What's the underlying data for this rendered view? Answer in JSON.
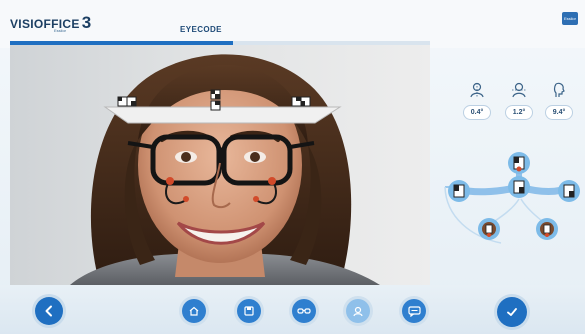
{
  "header": {
    "logo_text": "VISIOFFICE",
    "logo_number": "3",
    "logo_subtitle": "Essilor",
    "title": "EYECODE",
    "progress": 0.53,
    "brand_badge": "Essilor"
  },
  "measurements": {
    "angles": [
      {
        "icon": "head-tilt-icon",
        "value": "0.4°"
      },
      {
        "icon": "head-turn-icon",
        "value": "1.2°"
      },
      {
        "icon": "head-profile-icon",
        "value": "9.4°"
      }
    ]
  },
  "toolbar": {
    "back": "back-icon",
    "tools": [
      {
        "icon": "home-icon",
        "active": false
      },
      {
        "icon": "save-icon",
        "active": false
      },
      {
        "icon": "glasses-icon",
        "active": false
      },
      {
        "icon": "face-scan-icon",
        "active": true
      },
      {
        "icon": "chat-icon",
        "active": false
      }
    ],
    "confirm": "check-icon"
  },
  "colors": {
    "accent": "#1f6fc1",
    "accent_light": "#8fc0ea",
    "header_text": "#1c3f63",
    "panel_bg": "#e5eef5"
  }
}
